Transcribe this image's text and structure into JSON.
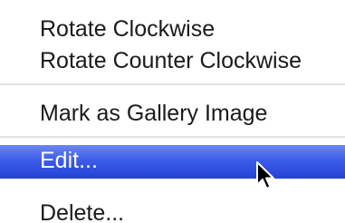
{
  "menu": {
    "items": [
      {
        "label": "Rotate Clockwise",
        "highlighted": false
      },
      {
        "label": "Rotate Counter Clockwise",
        "highlighted": false
      },
      {
        "label": "Mark as Gallery Image",
        "highlighted": false
      },
      {
        "label": "Edit...",
        "highlighted": true
      },
      {
        "label": "Delete...",
        "highlighted": false
      }
    ]
  },
  "colors": {
    "highlight_top": "#6e86f0",
    "highlight_bottom": "#2441d6",
    "text": "#1a1a1a",
    "text_highlighted": "#ffffff",
    "separator": "#e2e2e2"
  },
  "cursor": {
    "icon": "arrow-pointer-icon"
  }
}
